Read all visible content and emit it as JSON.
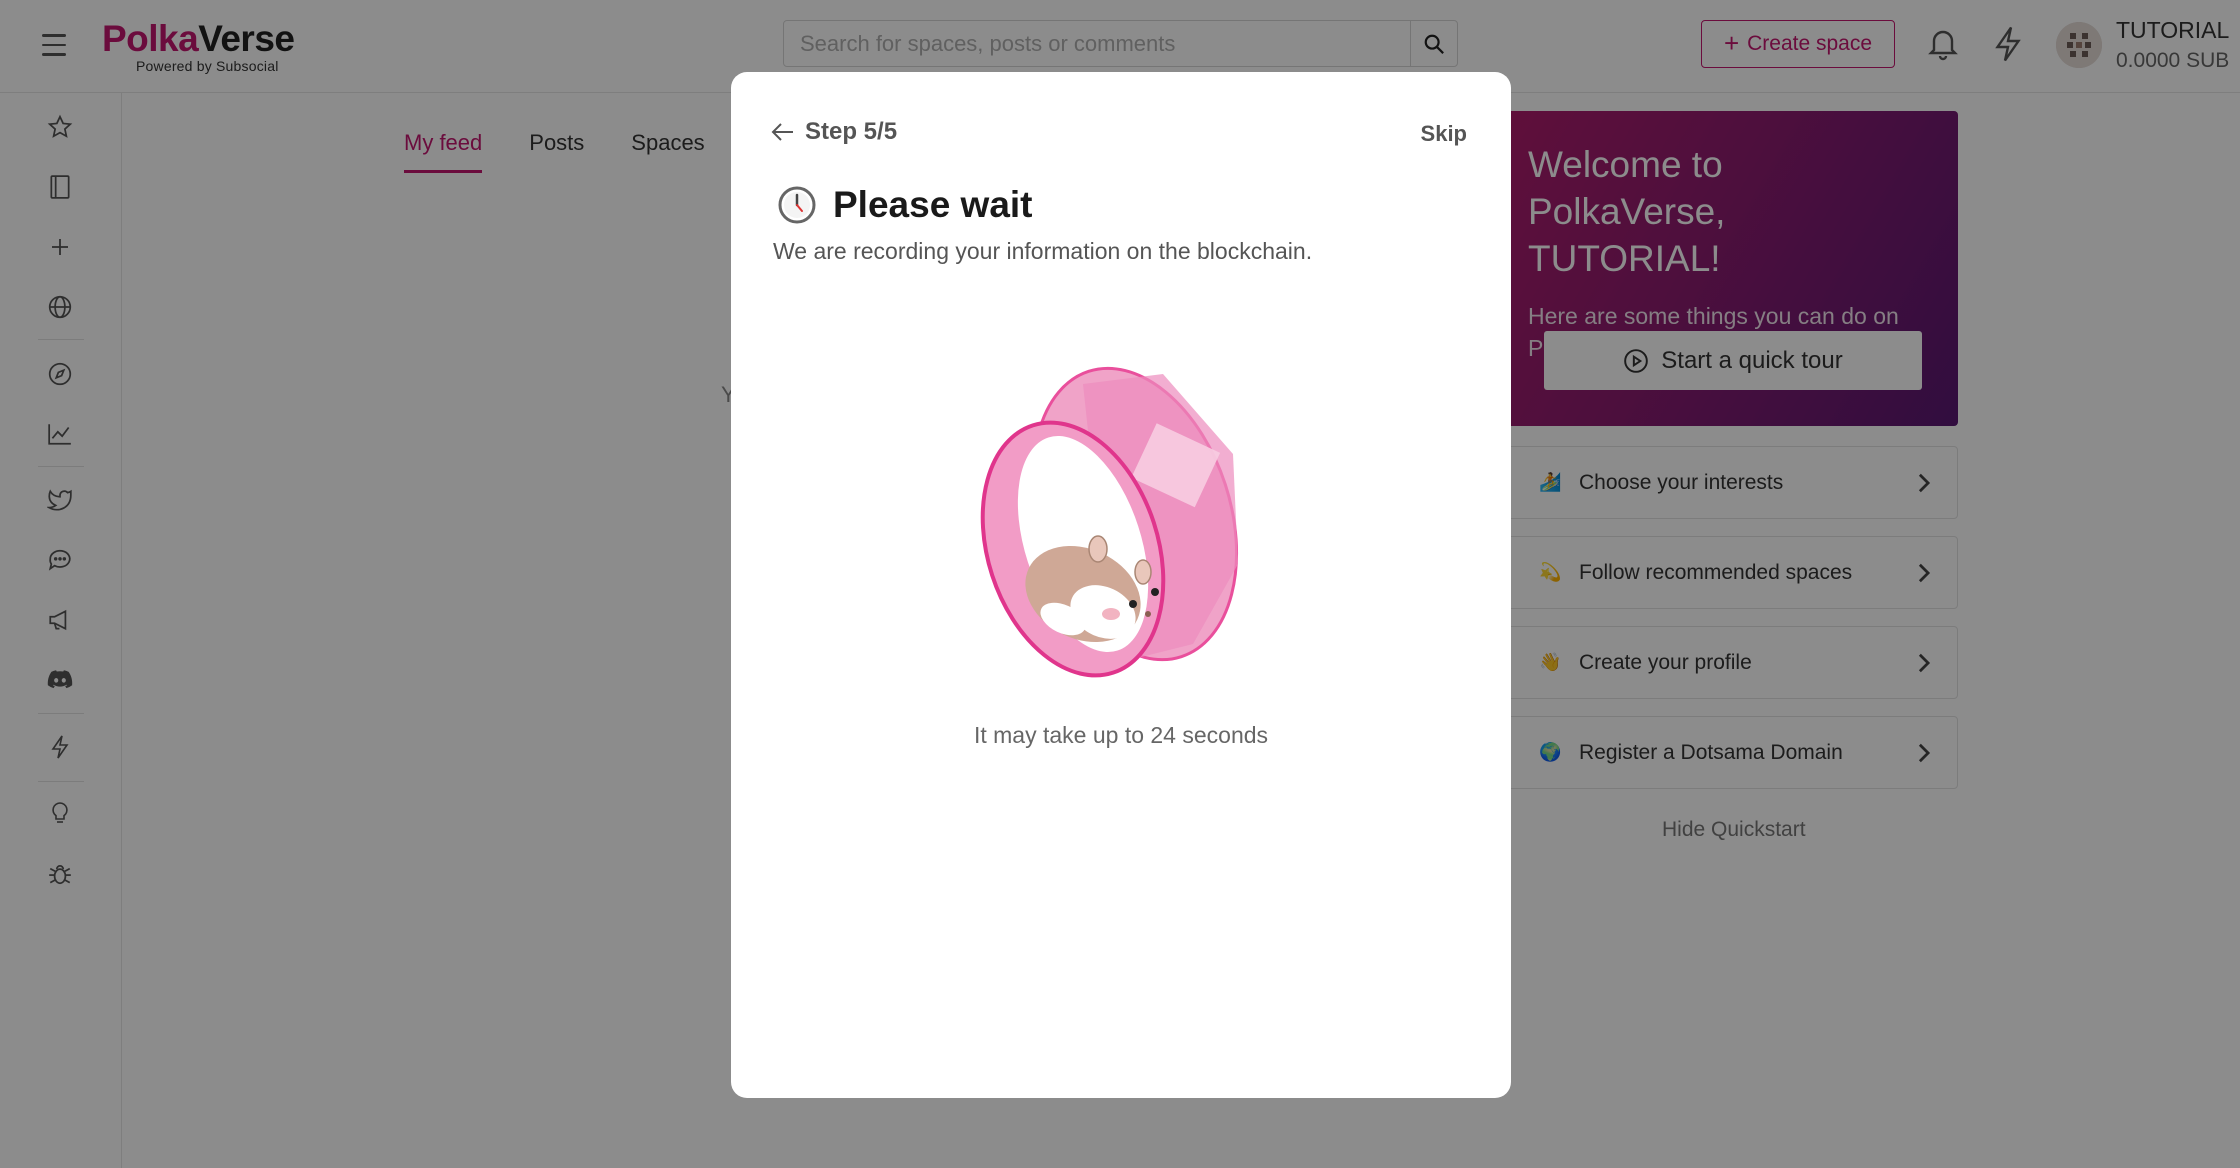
{
  "header": {
    "logo": {
      "part1": "Polka",
      "part2": "Verse",
      "powered_by": "Powered by Subsocial"
    },
    "search": {
      "placeholder": "Search for spaces, posts or comments"
    },
    "create_space_label": "Create space",
    "account": {
      "name": "TUTORIAL",
      "balance": "0.0000 SUB"
    }
  },
  "sidebar": {
    "icons": [
      "star-icon",
      "book-icon",
      "plus-icon",
      "globe-icon",
      "compass-icon",
      "chart-icon",
      "twitter-icon",
      "chat-icon",
      "megaphone-icon",
      "discord-icon",
      "bolt-icon",
      "bulb-icon",
      "bug-icon"
    ]
  },
  "feed": {
    "tabs": [
      "My feed",
      "Posts",
      "Spaces"
    ],
    "active_tab": "My feed",
    "partial_text": "Y"
  },
  "quickstart": {
    "welcome_title": "Welcome to PolkaVerse, TUTORIAL!",
    "welcome_text": "Here are some things you can do on PolkaVerse",
    "tour_button": "Start a quick tour",
    "items": [
      {
        "emoji": "🏄",
        "label": "Choose your interests"
      },
      {
        "emoji": "💫",
        "label": "Follow recommended spaces"
      },
      {
        "emoji": "👋",
        "label": "Create your profile"
      },
      {
        "emoji": "🌍",
        "label": "Register a Dotsama Domain"
      }
    ],
    "hide_label": "Hide Quickstart"
  },
  "modal": {
    "step": "Step 5/5",
    "skip": "Skip",
    "title": "Please wait",
    "description": "We are recording your information on the blockchain.",
    "hint": "It may take up to 24 seconds"
  },
  "colors": {
    "accent": "#c4166f",
    "welcome_gradient": [
      "#b01d6b",
      "#5a1873"
    ],
    "wheel": "#e94f9c"
  }
}
